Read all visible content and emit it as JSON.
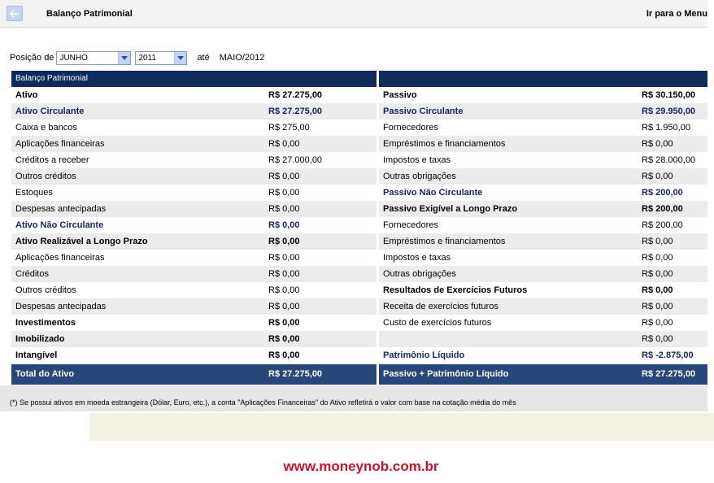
{
  "header": {
    "title": "Balanço Patrimonial",
    "menu_link": "Ir para o Menu"
  },
  "filter": {
    "label": "Posição de",
    "month": "JUNHO",
    "year": "2011",
    "until_label": "até",
    "until_value": "MAIO/2012"
  },
  "left_panel": {
    "header": "Balanço Patrimonial",
    "rows": [
      {
        "label": "Ativo",
        "value": "R$ 27.275,00",
        "style": "bold"
      },
      {
        "label": "Ativo Circulante",
        "value": "R$ 27.275,00",
        "style": "blue"
      },
      {
        "label": "Caixa e bancos",
        "value": "R$ 275,00",
        "style": "normal"
      },
      {
        "label": "Aplicações financeiras",
        "value": "R$ 0,00",
        "style": "normal"
      },
      {
        "label": "Créditos a receber",
        "value": "R$ 27.000,00",
        "style": "normal"
      },
      {
        "label": "Outros créditos",
        "value": "R$ 0,00",
        "style": "normal"
      },
      {
        "label": "Estoques",
        "value": "R$ 0,00",
        "style": "normal"
      },
      {
        "label": "Despesas antecipadas",
        "value": "R$ 0,00",
        "style": "normal"
      },
      {
        "label": "Ativo Não Circulante",
        "value": "R$ 0,00",
        "style": "blue"
      },
      {
        "label": "Ativo Realizável a Longo Prazo",
        "value": "R$ 0,00",
        "style": "bold"
      },
      {
        "label": "Aplicações financeiras",
        "value": "R$ 0,00",
        "style": "normal"
      },
      {
        "label": "Créditos",
        "value": "R$ 0,00",
        "style": "normal"
      },
      {
        "label": "Outros créditos",
        "value": "R$ 0,00",
        "style": "normal"
      },
      {
        "label": "Despesas antecipadas",
        "value": "R$ 0,00",
        "style": "normal"
      },
      {
        "label": "Investimentos",
        "value": "R$ 0,00",
        "style": "bold"
      },
      {
        "label": "Imobilizado",
        "value": "R$ 0,00",
        "style": "bold"
      },
      {
        "label": "Intangível",
        "value": "R$ 0,00",
        "style": "bold"
      }
    ],
    "total_label": "Total do Ativo",
    "total_value": "R$ 27.275,00"
  },
  "right_panel": {
    "header": "",
    "rows": [
      {
        "label": "Passivo",
        "value": "R$ 30.150,00",
        "style": "bold"
      },
      {
        "label": "Passivo Circulante",
        "value": "R$ 29.950,00",
        "style": "blue"
      },
      {
        "label": "Fornecedores",
        "value": "R$ 1.950,00",
        "style": "normal"
      },
      {
        "label": "Empréstimos e financiamentos",
        "value": "R$ 0,00",
        "style": "normal"
      },
      {
        "label": "Impostos e taxas",
        "value": "R$ 28.000,00",
        "style": "normal"
      },
      {
        "label": "Outras obrigações",
        "value": "R$ 0,00",
        "style": "normal"
      },
      {
        "label": "Passivo Não Circulante",
        "value": "R$ 200,00",
        "style": "blue"
      },
      {
        "label": "Passivo Exigível a Longo Prazo",
        "value": "R$ 200,00",
        "style": "bold"
      },
      {
        "label": "Fornecedores",
        "value": "R$ 200,00",
        "style": "normal"
      },
      {
        "label": "Empréstimos e financiamentos",
        "value": "R$ 0,00",
        "style": "normal"
      },
      {
        "label": "Impostos e taxas",
        "value": "R$ 0,00",
        "style": "normal"
      },
      {
        "label": "Outras obrigações",
        "value": "R$ 0,00",
        "style": "normal"
      },
      {
        "label": "Resultados de Exercícios Futuros",
        "value": "R$ 0,00",
        "style": "bold"
      },
      {
        "label": "Receita de exercícios futuros",
        "value": "R$ 0,00",
        "style": "normal"
      },
      {
        "label": "Custo de exercícios futuros",
        "value": "R$ 0,00",
        "style": "normal"
      },
      {
        "label": "",
        "value": "R$ 0,00",
        "style": "normal"
      },
      {
        "label": "Patrimônio Líquido",
        "value": "R$ -2.875,00",
        "style": "blue"
      }
    ],
    "total_label": "Passivo + Patrimônio Líquido",
    "total_value": "R$ 27.275,00"
  },
  "footnote": "(*) Se possui ativos em moeda estrangeira (Dólar, Euro, etc.), a conta \"Aplicações Financeiras\" do Ativo refletirá o valor com base na cotação média do mês",
  "watermark": "www.moneynob.com.br"
}
